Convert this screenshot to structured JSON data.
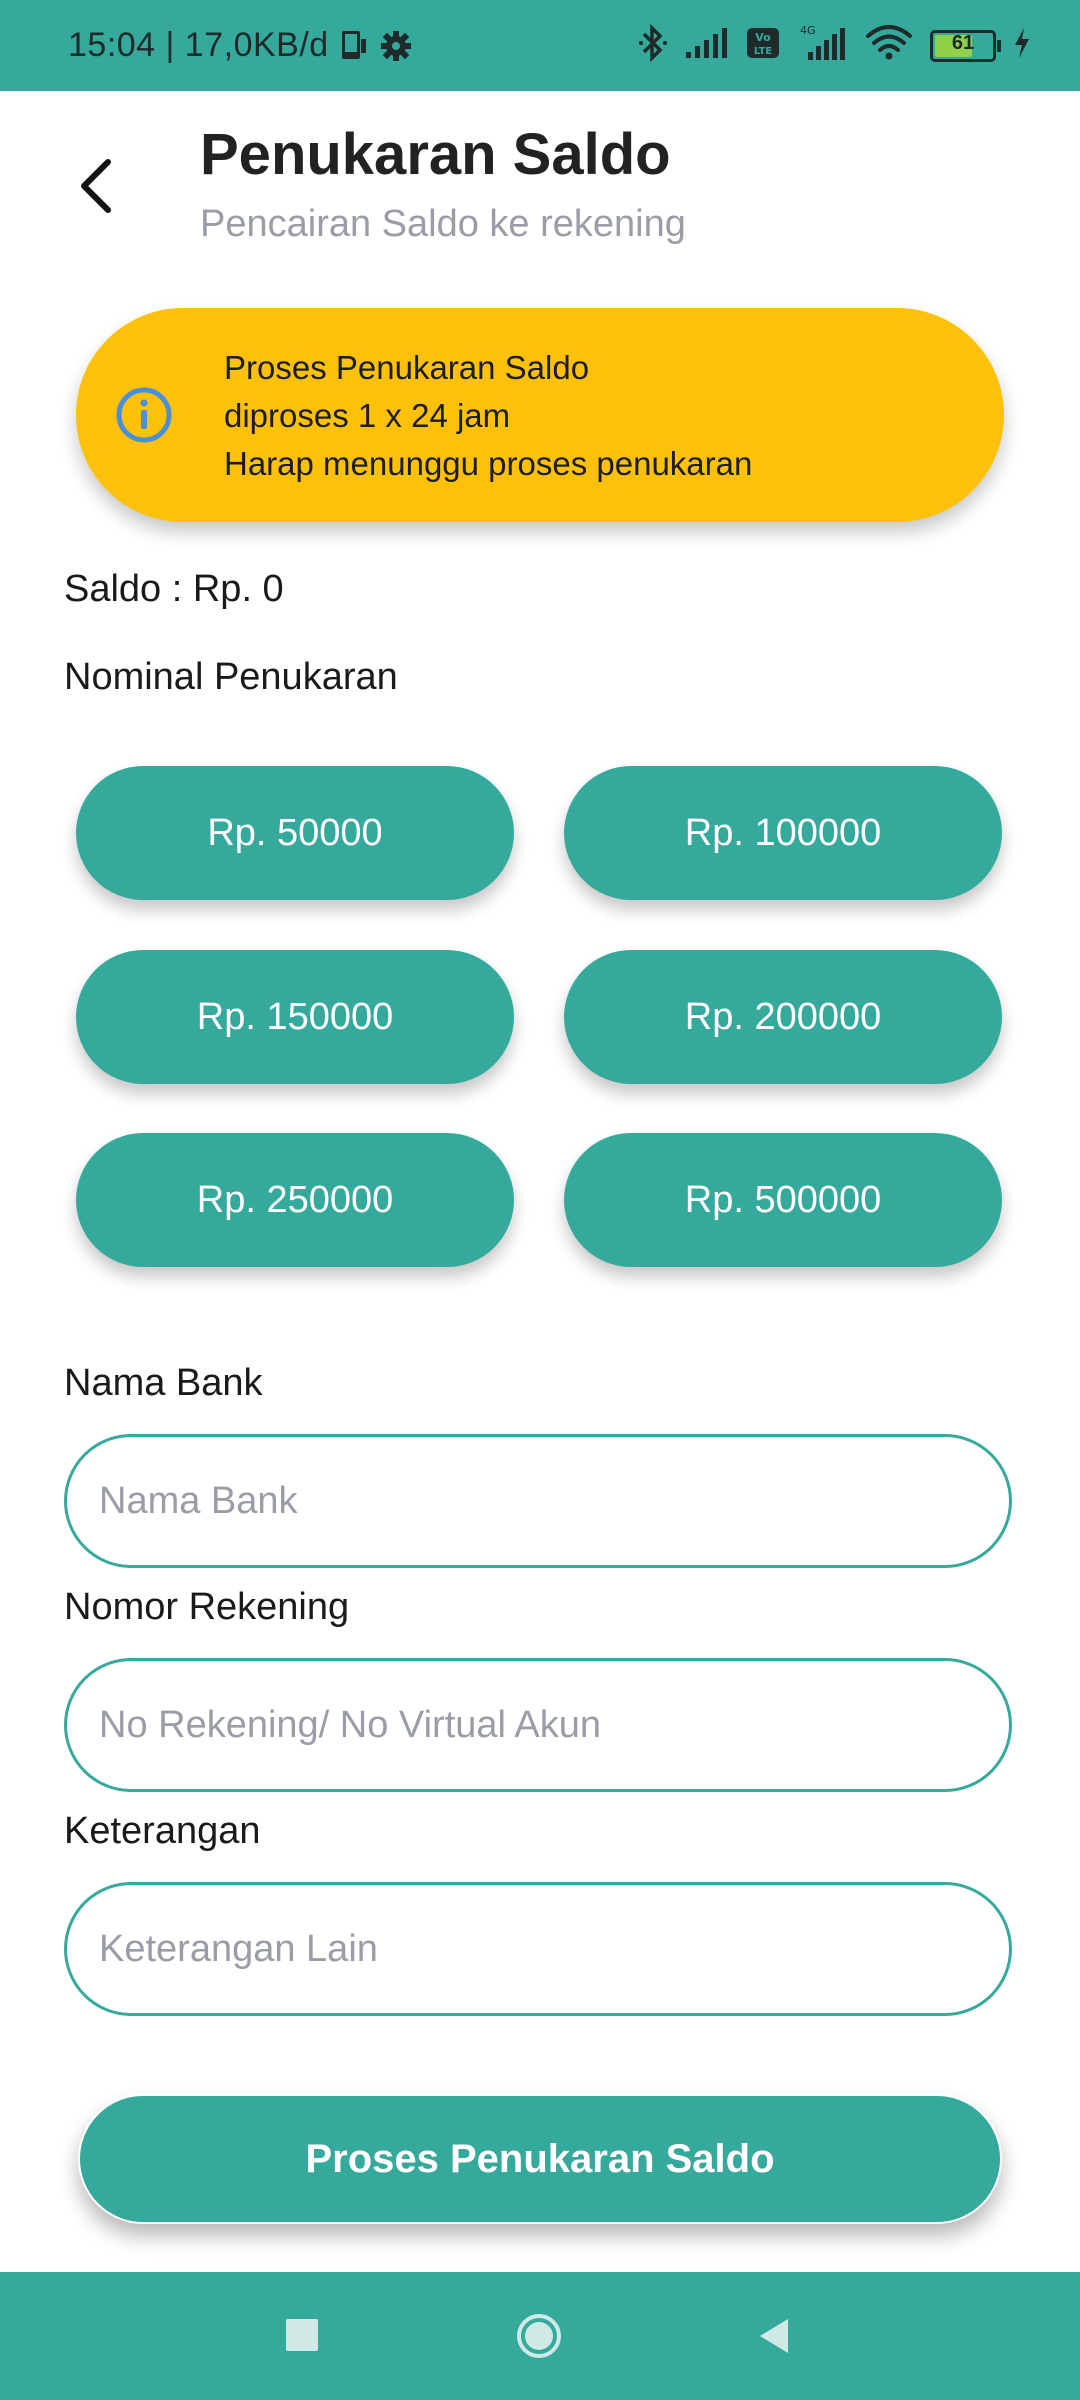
{
  "status_bar": {
    "time_speed": "15:04 | 17,0KB/d",
    "battery": "61",
    "network_badge": "Vo LTE",
    "network_type": "4G",
    "icons": [
      "phone-icon",
      "gear-icon",
      "bluetooth-icon",
      "signal-icon",
      "volte-icon",
      "signal-4g-icon",
      "wifi-icon",
      "battery-icon",
      "charging-icon"
    ]
  },
  "header": {
    "title": "Penukaran Saldo",
    "subtitle": "Pencairan Saldo ke rekening",
    "back_icon": "chevron-left-icon"
  },
  "info_banner": {
    "icon": "info-icon",
    "lines": [
      "Proses Penukaran Saldo",
      "diproses 1 x 24 jam",
      "Harap menunggu proses penukaran"
    ]
  },
  "balance": {
    "text": "Saldo : Rp. 0"
  },
  "nominal": {
    "label": "Nominal Penukaran",
    "options": [
      "Rp. 50000",
      "Rp. 100000",
      "Rp. 150000",
      "Rp. 200000",
      "Rp. 250000",
      "Rp. 500000"
    ]
  },
  "form": {
    "bank": {
      "label": "Nama Bank",
      "placeholder": "Nama Bank",
      "value": ""
    },
    "account": {
      "label": "Nomor Rekening",
      "placeholder": "No Rekening/ No Virtual Akun",
      "value": ""
    },
    "notes": {
      "label": "Keterangan",
      "placeholder": "Keterangan Lain",
      "value": ""
    }
  },
  "submit": {
    "label": "Proses Penukaran Saldo"
  },
  "nav_bar": {
    "icons": [
      "recent-apps-icon",
      "home-icon",
      "back-icon"
    ]
  },
  "colors": {
    "primary": "#35a99c",
    "banner": "#fdc10c",
    "info_icon": "#4a8fd8",
    "placeholder": "#9a9da8"
  }
}
